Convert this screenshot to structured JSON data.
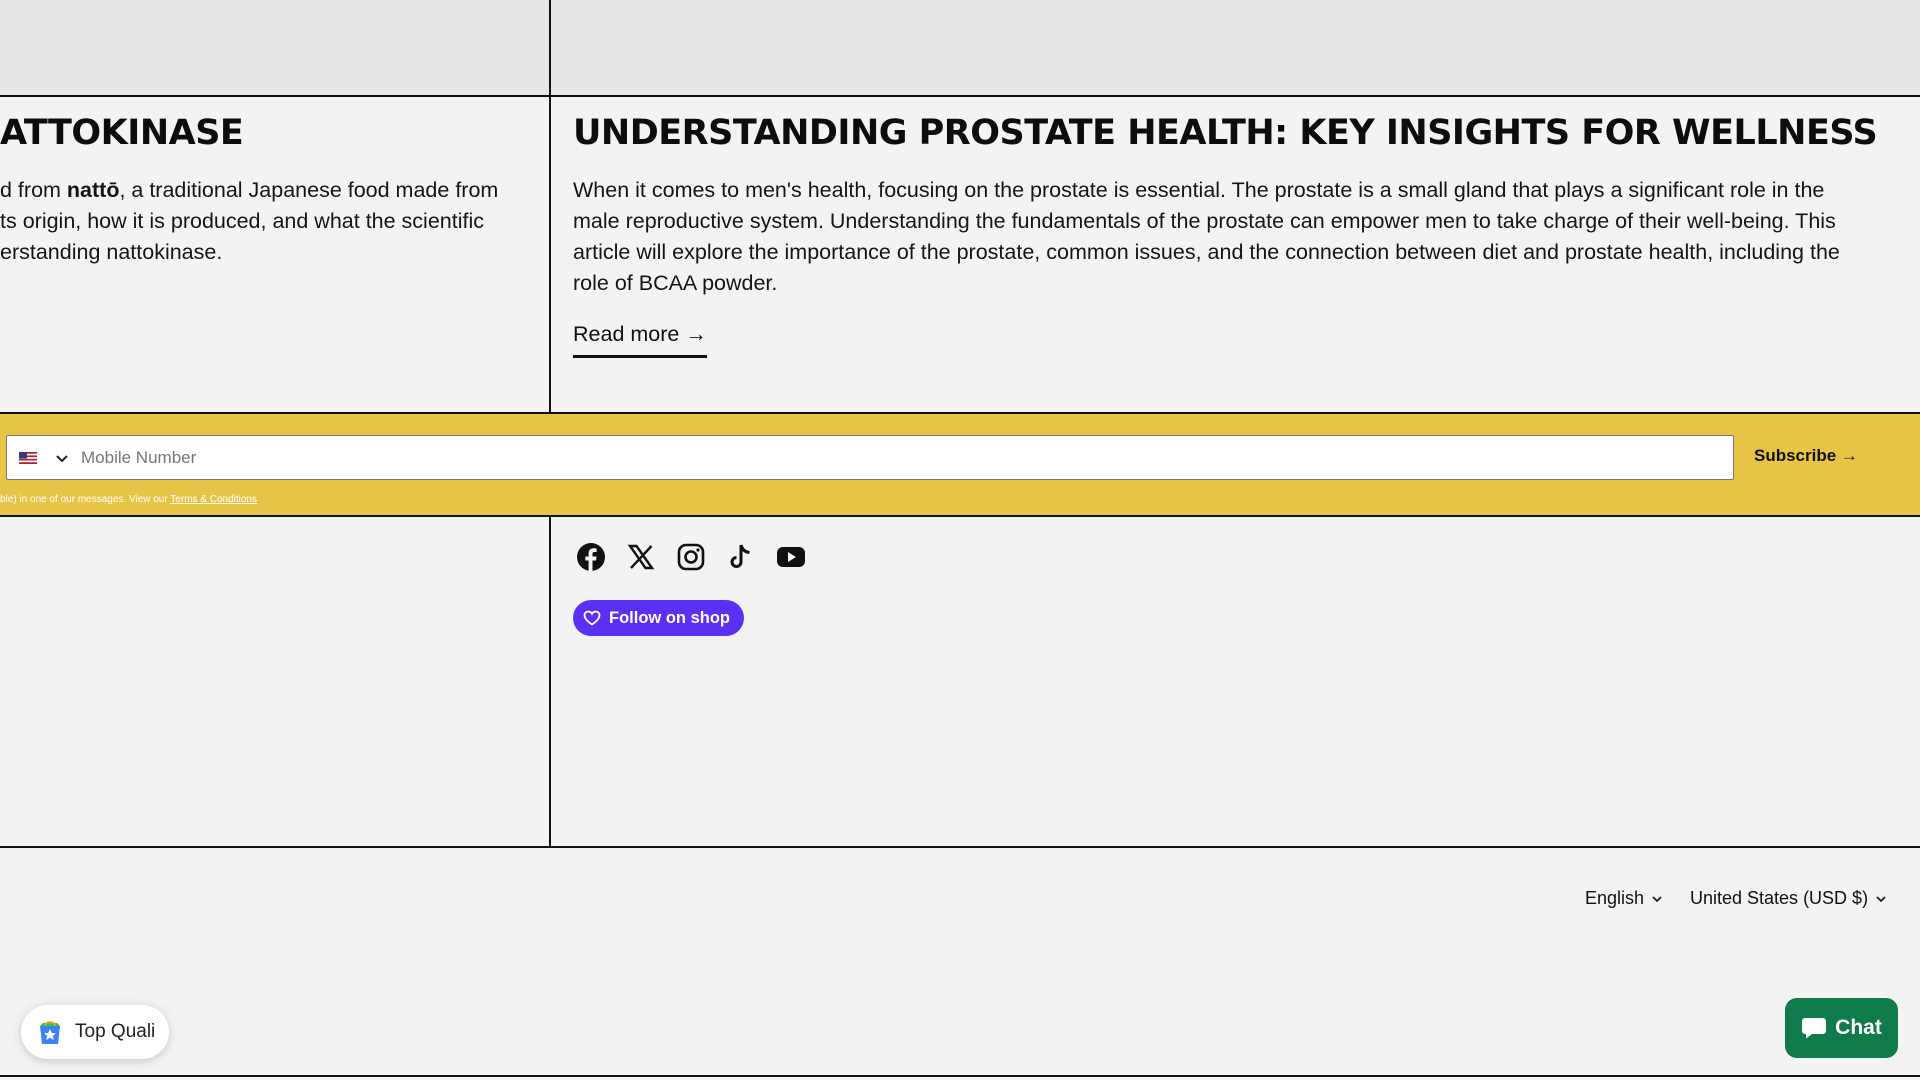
{
  "articles": [
    {
      "title": "ATTOKINASE",
      "excerpt_lines": [
        {
          "pre": "d from ",
          "bold": "nattō",
          "post": ", a traditional Japanese food made from"
        },
        {
          "pre": "ts origin, how it is produced, and what the scientific",
          "bold": "",
          "post": ""
        },
        {
          "pre": "erstanding nattokinase.",
          "bold": "",
          "post": ""
        }
      ]
    },
    {
      "title": "UNDERSTANDING PROSTATE HEALTH: KEY INSIGHTS FOR WELLNESS",
      "excerpt_lines": [
        "When it comes to men's health, focusing on the prostate is essential. The prostate is a small gland that plays a significant role in the",
        "male reproductive system. Understanding the fundamentals of the prostate can empower men to take charge of their well-being. This",
        "article will explore the importance of the prostate, common issues, and the connection between diet and prostate health, including the",
        "role of BCAA powder."
      ],
      "read_more": "Read more →"
    }
  ],
  "sms_signup": {
    "country_flag": "us-flag-icon",
    "placeholder": "Mobile Number",
    "subscribe_label": "Subscribe →",
    "terms_prefix": "ble) in one of our messages. View our ",
    "terms_link": "Terms & Conditions",
    "band_color": "#e7c446"
  },
  "social": {
    "icons": [
      "facebook-icon",
      "x-icon",
      "instagram-icon",
      "tiktok-icon",
      "youtube-icon"
    ],
    "follow_label": "Follow on shop",
    "follow_color": "#5a31f4"
  },
  "footer": {
    "language": "English",
    "currency": "United States (USD $)"
  },
  "badge": {
    "label": "Top Quali"
  },
  "chat": {
    "label": "Chat",
    "color": "#0f7a4a"
  }
}
